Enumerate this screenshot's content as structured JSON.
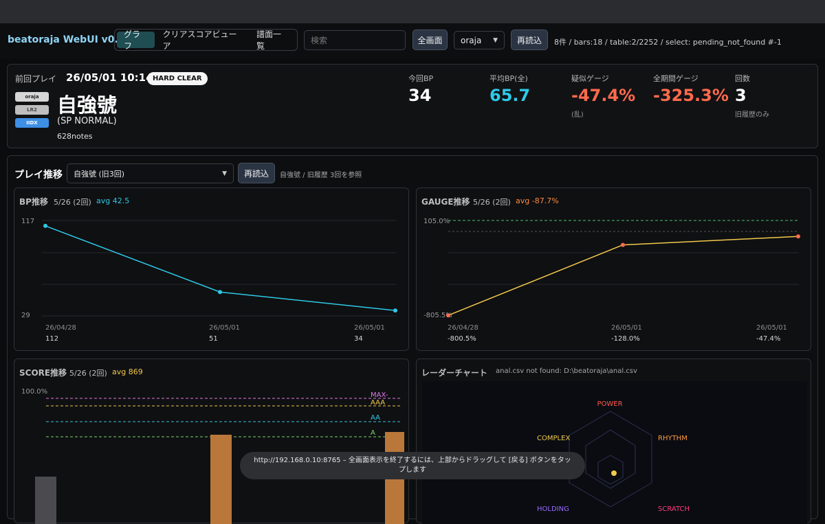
{
  "header": {
    "app_title": "beatoraja WebUI v0.17",
    "tabs": [
      {
        "label": "グラフ",
        "active": true
      },
      {
        "label": "クリアスコアビューア",
        "active": false
      },
      {
        "label": "譜面一覧",
        "active": false
      }
    ],
    "search_placeholder": "検索",
    "fullscreen_label": "全画面",
    "player_select": "oraja",
    "reload_label": "再読込",
    "status": "8件 / bars:18 / table:2/2252 / select: pending_not_found #-1"
  },
  "summary": {
    "prev_play_label": "前回プレイ",
    "date": "26/05/01 10:14",
    "clear_badge": "HARD CLEAR",
    "sources": [
      "oraja",
      "LR2",
      "IIDX"
    ],
    "song_title": "自強號",
    "difficulty": "(SP NORMAL)",
    "notes": "628notes",
    "stats": [
      {
        "label": "今回BP",
        "value": "34",
        "sub": "",
        "color": "#ffffff"
      },
      {
        "label": "平均BP(全)",
        "value": "65.7",
        "sub": "",
        "color": "#2ec9e8"
      },
      {
        "label": "疑似ゲージ",
        "value": "-47.4%",
        "sub": "(乱)",
        "color": "#ff6a4d"
      },
      {
        "label": "全期間ゲージ",
        "value": "-325.3%",
        "sub": "",
        "color": "#ff6a4d"
      },
      {
        "label": "回数",
        "value": "3",
        "sub": "旧履歴のみ",
        "color": "#ffffff"
      }
    ]
  },
  "trend": {
    "title": "プレイ推移",
    "select": "自強號 (旧3回)",
    "reload_label": "再読込",
    "note": "自強號 / 旧履歴 3回を参照"
  },
  "bp_panel": {
    "title": "BP推移",
    "count": "5/26 (2回)",
    "avg": "avg 42.5",
    "avg_color": "#2ec9e8",
    "y_top_label": "117",
    "y_bottom_label": "29",
    "dates": [
      "26/04/28",
      "26/05/01",
      "26/05/01"
    ],
    "values_text": [
      "112",
      "51",
      "34"
    ]
  },
  "gauge_panel": {
    "title": "GAUGE推移",
    "count": "5/26 (2回)",
    "avg": "avg -87.7%",
    "avg_color": "#ff8a3d",
    "y_top_label": "105.0%",
    "y_bottom_label": "-805.5%",
    "dates": [
      "26/04/28",
      "26/05/01",
      "26/05/01"
    ],
    "values_text": [
      "-800.5%",
      "-128.0%",
      "-47.4%"
    ]
  },
  "score_panel": {
    "title": "SCORE推移",
    "count": "5/26 (2回)",
    "avg": "avg 869",
    "avg_color": "#f2c94c",
    "y_top_label": "100.0%",
    "grade_lines": [
      {
        "label": "MAX-",
        "color": "#e07ae8"
      },
      {
        "label": "AAA",
        "color": "#f2c94c"
      },
      {
        "label": "AA",
        "color": "#34c6e0"
      },
      {
        "label": "A",
        "color": "#7ad66a"
      }
    ]
  },
  "radar_panel": {
    "title": "レーダーチャート",
    "note": "anal.csv not found: D:\\beatoraja\\anal.csv",
    "axes": [
      {
        "label": "POWER",
        "color": "#ff5a4a"
      },
      {
        "label": "RHYTHM",
        "color": "#ff9a3d"
      },
      {
        "label": "SCRATCH",
        "color": "#ff3d7a"
      },
      {
        "label": "HOLDING",
        "color": "#9a6bff"
      },
      {
        "label": "COMPLEX",
        "color": "#f2c94c"
      }
    ]
  },
  "toast": "http://192.168.0.10:8765 – 全画面表示を終了するには、上部からドラッグして [戻る] ボタンをタップします",
  "chart_data": [
    {
      "type": "line",
      "title": "BP推移",
      "x": [
        "26/04/28",
        "26/05/01",
        "26/05/01"
      ],
      "series": [
        {
          "values": [
            112,
            51,
            34
          ]
        }
      ],
      "ylim": [
        29,
        117
      ]
    },
    {
      "type": "line",
      "title": "GAUGE推移",
      "x": [
        "26/04/28",
        "26/05/01",
        "26/05/01"
      ],
      "series": [
        {
          "values": [
            -800.5,
            -128.0,
            -47.4
          ]
        }
      ],
      "ylim": [
        -805.5,
        105.0
      ]
    },
    {
      "type": "bar",
      "title": "SCORE推移",
      "ylim": [
        0,
        100
      ],
      "grade_lines": {
        "MAX-": 94.4,
        "AAA": 88.9,
        "AA": 77.8,
        "A": 66.7
      }
    }
  ]
}
